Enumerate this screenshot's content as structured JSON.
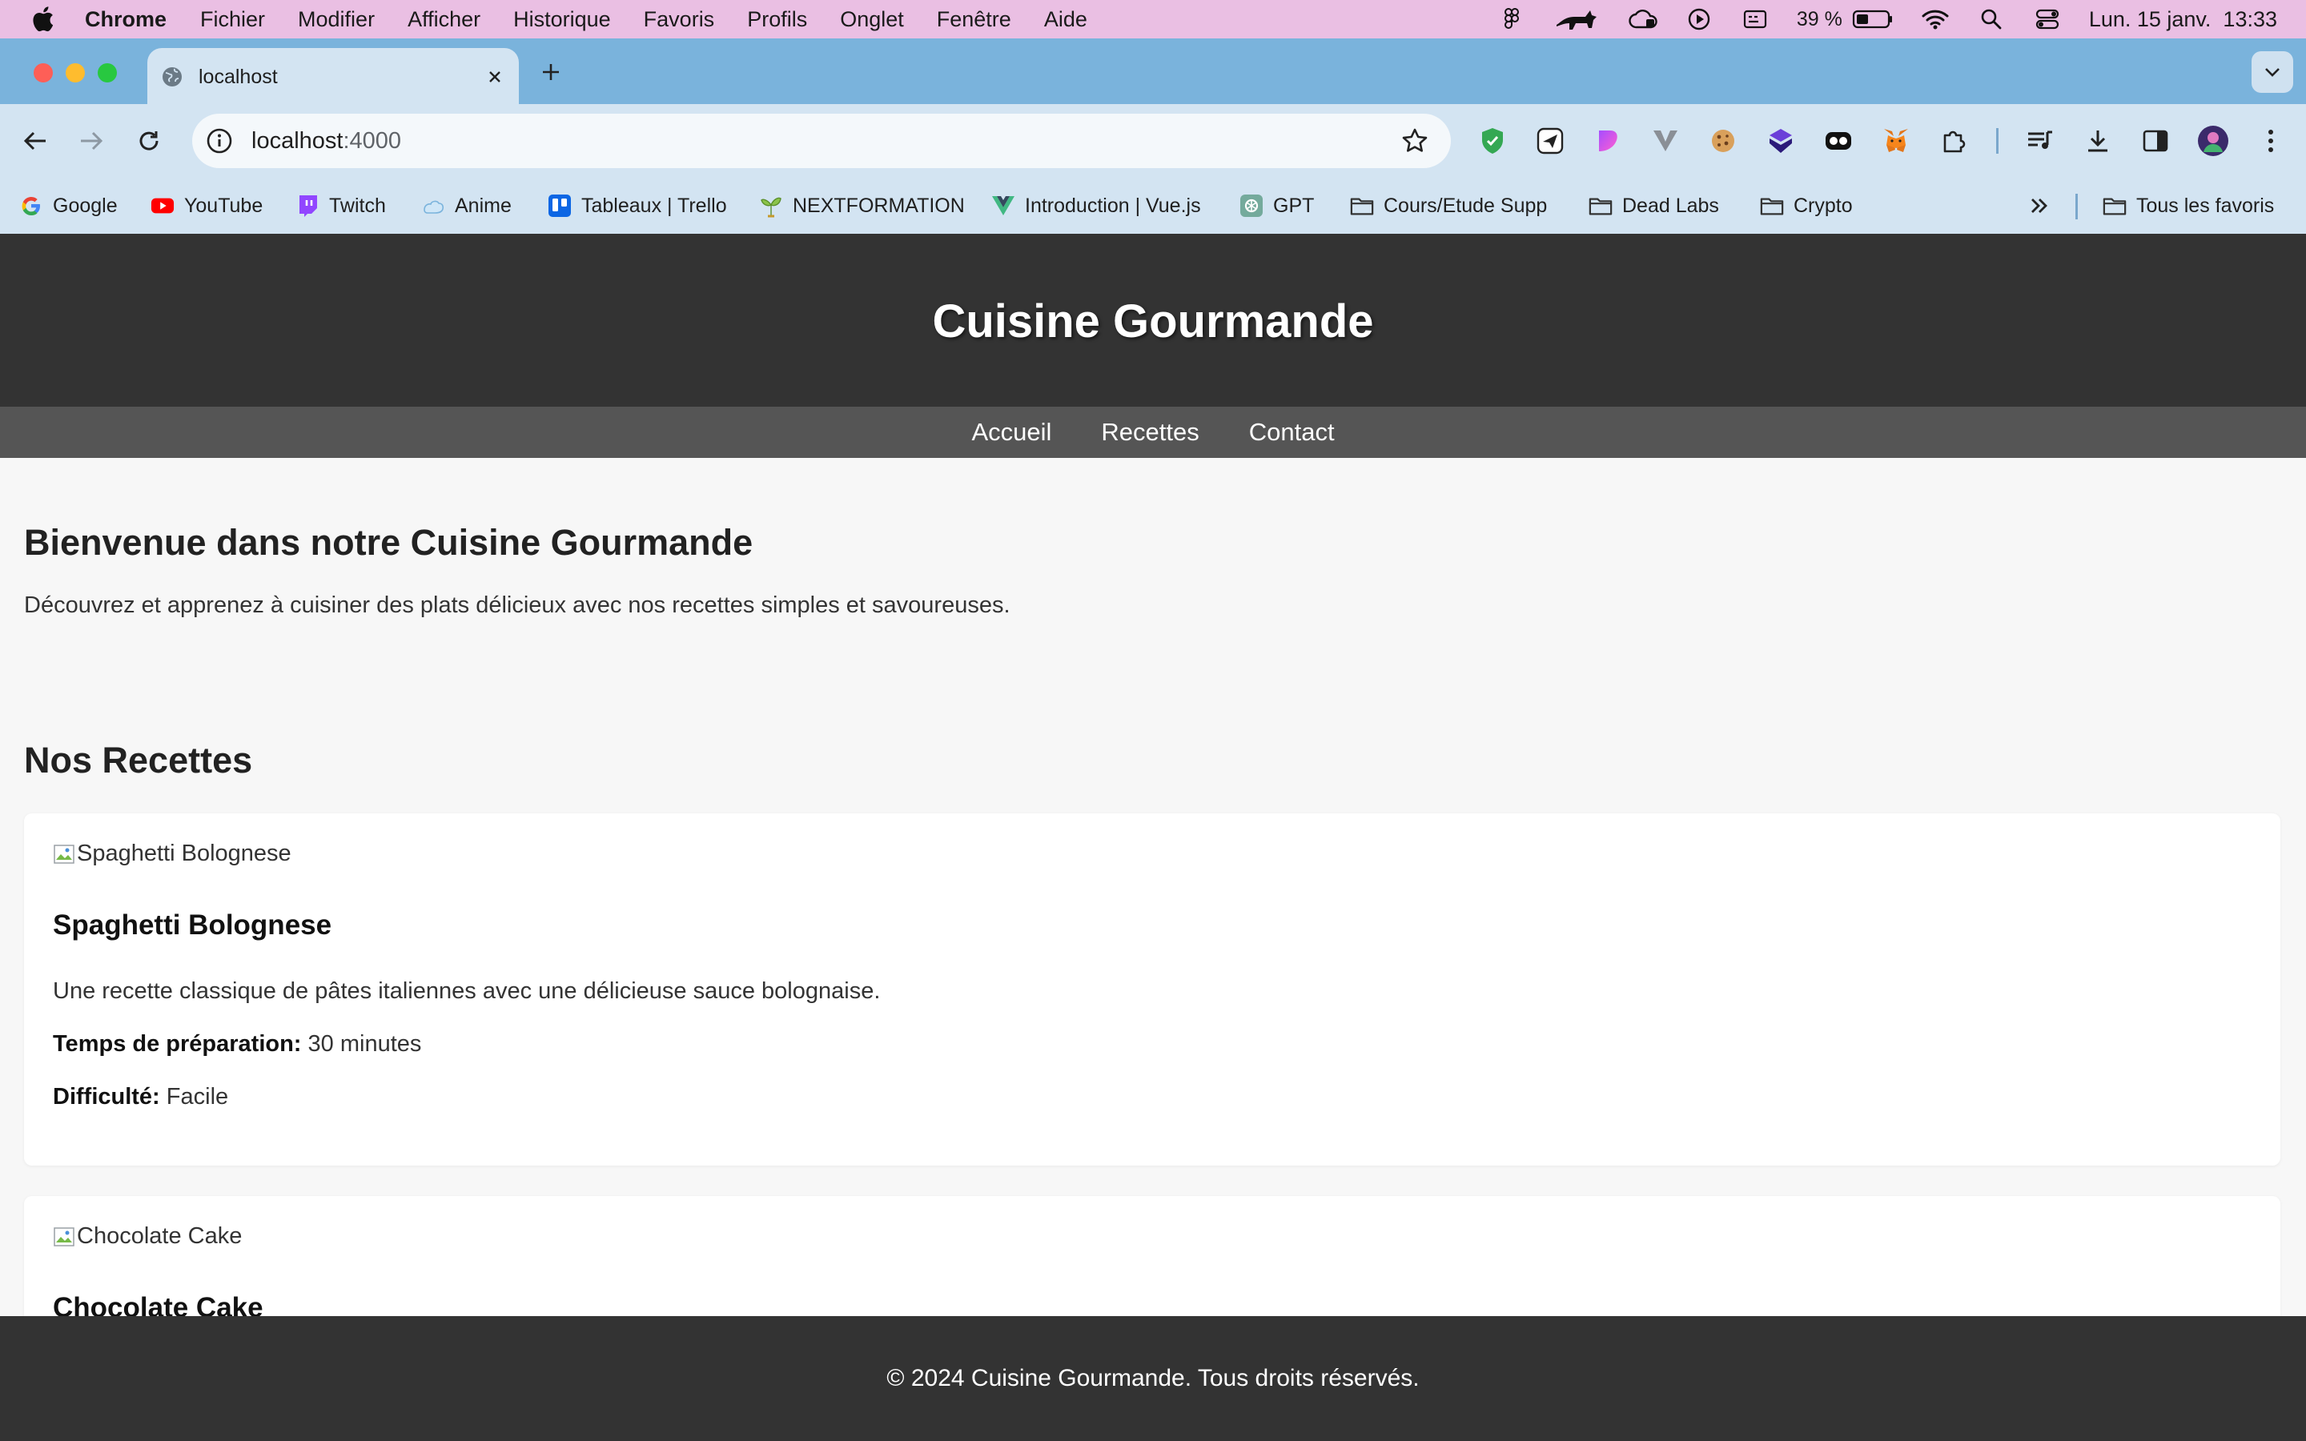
{
  "menubar": {
    "app": "Chrome",
    "items": [
      "Fichier",
      "Modifier",
      "Afficher",
      "Historique",
      "Favoris",
      "Profils",
      "Onglet",
      "Fenêtre",
      "Aide"
    ],
    "battery": "39 %",
    "datetime": "Lun. 15 janv.  13:33"
  },
  "tab": {
    "title": "localhost"
  },
  "omnibox": {
    "host": "localhost",
    "port": ":4000"
  },
  "bookmarks": [
    {
      "label": "Google",
      "icon": "google-icon"
    },
    {
      "label": "YouTube",
      "icon": "youtube-icon"
    },
    {
      "label": "Twitch",
      "icon": "twitch-icon"
    },
    {
      "label": "Anime",
      "icon": "anime-icon"
    },
    {
      "label": "Tableaux | Trello",
      "icon": "trello-icon"
    },
    {
      "label": "NEXTFORMATION",
      "icon": "nextformation-icon"
    },
    {
      "label": "Introduction | Vue.js",
      "icon": "vuejs-icon"
    },
    {
      "label": "GPT",
      "icon": "gpt-icon"
    },
    {
      "label": "Cours/Etude Supp",
      "icon": "folder-icon"
    },
    {
      "label": "Dead Labs",
      "icon": "folder-icon"
    },
    {
      "label": "Crypto",
      "icon": "folder-icon"
    }
  ],
  "bookmarks_all": "Tous les favoris",
  "site": {
    "title": "Cuisine Gourmande",
    "nav": [
      "Accueil",
      "Recettes",
      "Contact"
    ],
    "intro_heading": "Bienvenue dans notre Cuisine Gourmande",
    "intro_text": "Découvrez et apprenez à cuisiner des plats délicieux avec nos recettes simples et savoureuses.",
    "recipes_heading": "Nos Recettes",
    "recipes": [
      {
        "img_alt": "Spaghetti Bolognese",
        "name": "Spaghetti Bolognese",
        "description": "Une recette classique de pâtes italiennes avec une délicieuse sauce bolognaise.",
        "prep_label": "Temps de préparation:",
        "prep_value": "30 minutes",
        "difficulty_label": "Difficulté:",
        "difficulty_value": "Facile"
      },
      {
        "img_alt": "Chocolate Cake",
        "name": "Chocolate Cake"
      }
    ],
    "footer": "© 2024 Cuisine Gourmande. Tous droits réservés."
  },
  "colors": {
    "menubar_bg": "#eabfe3",
    "tabstrip_bg": "#7ab3dc",
    "toolbar_bg": "#d3e4f2",
    "header_bg": "#333333",
    "nav_bg": "#555555"
  }
}
